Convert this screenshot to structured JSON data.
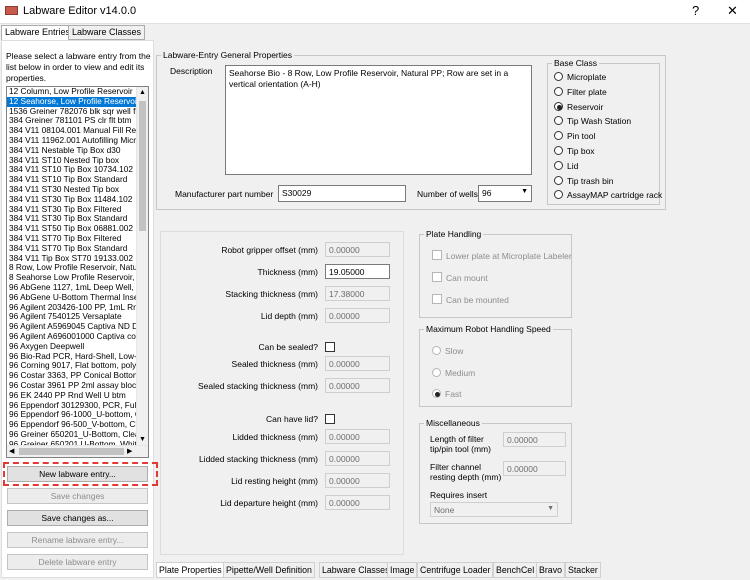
{
  "window": {
    "title": "Labware Editor v14.0.0",
    "help_glyph": "?",
    "close_glyph": "✕"
  },
  "top_tabs": [
    "Labware Entries",
    "Labware Classes"
  ],
  "left": {
    "help_text": "Please select a labware entry from the list below in order to view and edit its properties.",
    "entries": [
      "12 Column, Low Profile Reservoir",
      "12 Seahorse, Low Profile Reservoir",
      "1536 Greiner 782076 blk sqr well flt",
      "384 Greiner 781101 PS clr flt btm",
      "384 V11 08104.001 Manual Fill Rese",
      "384 V11 11962.001 Autofilling Micro",
      "384 V11 Nestable Tip Box d30",
      "384 V11 ST10 Nested Tip box",
      "384 V11 ST10 Tip Box 10734.102",
      "384 V11 ST10 Tip Box Standard",
      "384 V11 ST30 Nested Tip box",
      "384 V11 ST30 Tip Box 11484.102",
      "384 V11 ST30 Tip Box Filtered",
      "384 V11 ST30 Tip Box Standard",
      "384 V11 ST50 Tip Box 06881.002",
      "384 V11 ST70 Tip Box Filtered",
      "384 V11 ST70 Tip Box Standard",
      "384 V11 Tip Box ST70 19133.002",
      "8 Row, Low Profile Reservoir, Natu",
      "8 Seahorse Low Profile Reservoir, N",
      "96 AbGene 1127, 1mL Deep Well, S",
      "96 AbGene U-Bottom Thermal Inser",
      "96 Agilent 203426-100 PP, 1mL Rn",
      "96 Agilent 7540125 Versaplate",
      "96 Agilent A5969045 Captiva ND D",
      "96 Agilent A696001000 Captiva col",
      "96 Axygen Deepwell",
      "96 Bio-Rad PCR, Hard-Shell, Low-Pr",
      "96 Corning 9017, Flat bottom, poly",
      "96 Costar 3363, PP Conical Bottom",
      "96 Costar 3961 PP 2ml assay block",
      "96 EK 2440 PP Rnd Well U btm",
      "96 Eppendorf 30129300, PCR, Full",
      "96 Eppendorf 96-1000_U-bottom, C",
      "96 Eppendorf 96-500_V-bottom, Cle",
      "96 Greiner 650201_U-Bottom, Clea",
      "96 Greiner 650201 U-Bottom, Whit"
    ],
    "selected_index": 1,
    "buttons": {
      "new": "New labware entry...",
      "save": "Save changes",
      "save_as": "Save changes as...",
      "rename": "Rename labware entry...",
      "delete": "Delete labware entry"
    }
  },
  "general": {
    "group_title": "Labware-Entry General Properties",
    "description_label": "Description",
    "description": "Seahorse Bio - 8 Row, Low Profile Reservoir, Natural PP; Row are set in a vertical orientation (A-H)",
    "part_label": "Manufacturer part number",
    "part_value": "S30029",
    "wells_label": "Number of wells",
    "wells_value": "96"
  },
  "base_class": {
    "title": "Base Class",
    "options": [
      "Microplate",
      "Filter plate",
      "Reservoir",
      "Tip Wash Station",
      "Pin tool",
      "Tip box",
      "Lid",
      "Tip trash bin",
      "AssayMAP cartridge rack"
    ],
    "selected": "Reservoir"
  },
  "props": {
    "gripper_label": "Robot gripper offset (mm)",
    "gripper_value": "0.00000",
    "thickness_label": "Thickness (mm)",
    "thickness_value": "19.05000",
    "stacking_label": "Stacking thickness (mm)",
    "stacking_value": "17.38000",
    "lid_depth_label": "Lid depth (mm)",
    "lid_depth_value": "0.00000",
    "can_sealed_label": "Can be sealed?",
    "sealed_thickness_label": "Sealed thickness (mm)",
    "sealed_thickness_value": "0.00000",
    "sealed_stacking_label": "Sealed stacking thickness (mm)",
    "sealed_stacking_value": "0.00000",
    "can_lid_label": "Can have lid?",
    "lidded_thickness_label": "Lidded thickness (mm)",
    "lidded_thickness_value": "0.00000",
    "lidded_stacking_label": "Lidded stacking thickness (mm)",
    "lidded_stacking_value": "0.00000",
    "lid_resting_label": "Lid resting height (mm)",
    "lid_resting_value": "0.00000",
    "lid_departure_label": "Lid departure height (mm)",
    "lid_departure_value": "0.00000"
  },
  "plate_handling": {
    "title": "Plate Handling",
    "lower": "Lower plate at Microplate Labeler",
    "mount": "Can mount",
    "mounted": "Can be mounted"
  },
  "speed": {
    "title": "Maximum Robot Handling Speed",
    "options": [
      "Slow",
      "Medium",
      "Fast"
    ],
    "selected": "Fast"
  },
  "misc": {
    "title": "Miscellaneous",
    "filter_label_1": "Length of filter",
    "filter_label_2": "tip/pin tool (mm)",
    "filter_value": "0.00000",
    "channel_label_1": "Filter channel",
    "channel_label_2": "resting depth (mm)",
    "channel_value": "0.00000",
    "insert_label": "Requires insert",
    "insert_value": "None"
  },
  "bottom_tabs": [
    "Plate Properties",
    "Pipette/Well Definition",
    "Labware Classes",
    "Image",
    "Centrifuge Loader",
    "BenchCel",
    "Bravo",
    "Stacker"
  ]
}
